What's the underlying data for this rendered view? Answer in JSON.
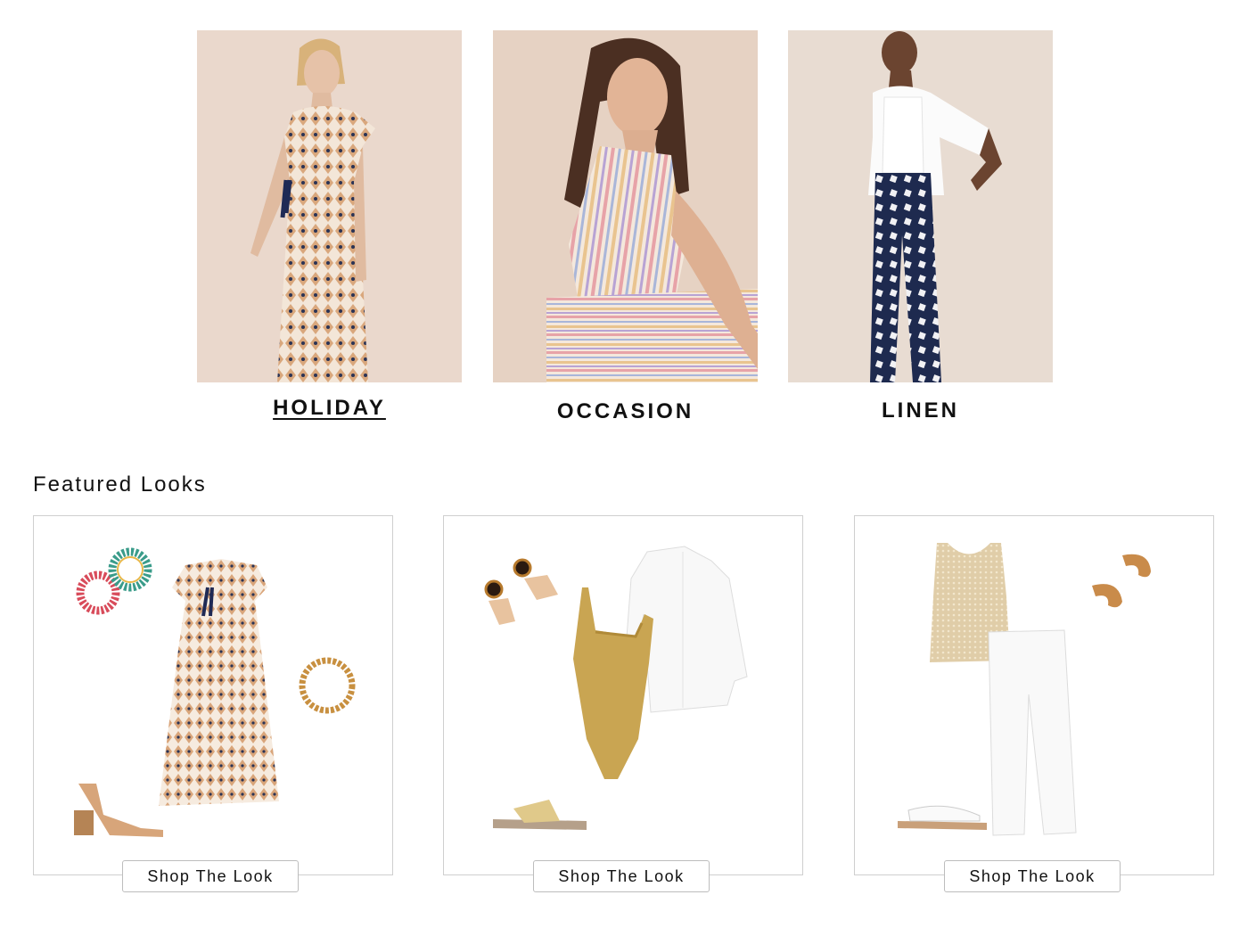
{
  "categories": [
    {
      "label": "HOLIDAY",
      "image": "woman-in-patterned-maxi-dress-photo",
      "active": true
    },
    {
      "label": "OCCASION",
      "image": "woman-in-striped-halter-jumpsuit-photo",
      "active": false
    },
    {
      "label": "LINEN",
      "image": "woman-in-navy-print-trousers-photo",
      "active": false
    }
  ],
  "featured": {
    "title": "Featured Looks",
    "looks": [
      {
        "items": [
          "tassel-hoop-earrings",
          "printed-maxi-dress",
          "gold-chain-bracelet",
          "block-heel-sandals"
        ],
        "button": "Shop The Look"
      },
      {
        "items": [
          "tortoiseshell-drop-earrings",
          "gold-swimsuit",
          "white-linen-shirt",
          "gold-slide-sandals"
        ],
        "button": "Shop The Look"
      },
      {
        "items": [
          "crochet-knit-tank",
          "gold-hoop-earrings",
          "white-wide-leg-jeans",
          "white-flat-sandals"
        ],
        "button": "Shop The Look"
      }
    ]
  },
  "colors": {
    "photo_bg": "#e9ddd4",
    "text": "#111111",
    "card_border": "#cfcfcf"
  }
}
